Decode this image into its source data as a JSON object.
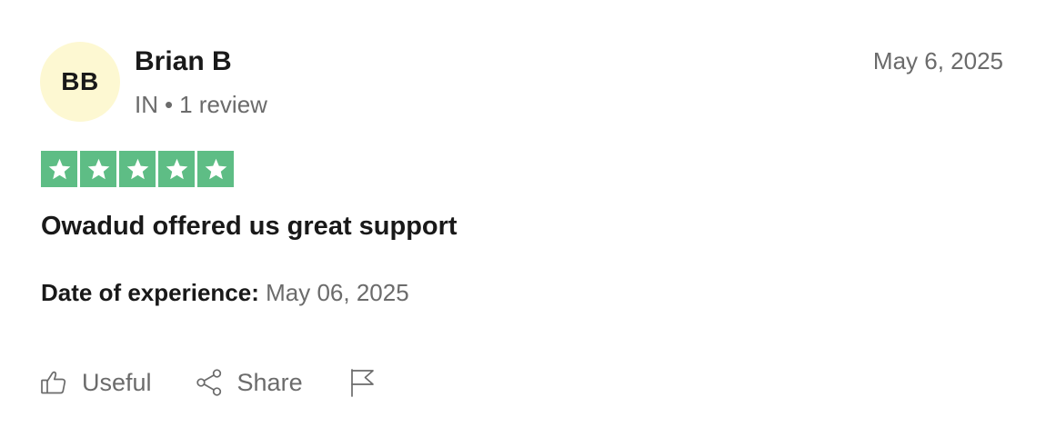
{
  "reviewer": {
    "initials": "BB",
    "name": "Brian B",
    "country": "IN",
    "separator": "•",
    "review_count": "1 review"
  },
  "review": {
    "date": "May 6, 2025",
    "rating": 5,
    "rating_max": 5,
    "title": "Owadud offered us great support",
    "experience_label": "Date of experience:",
    "experience_date": "May 06, 2025"
  },
  "actions": {
    "useful_label": "Useful",
    "share_label": "Share",
    "useful_icon": "thumbs-up-icon",
    "share_icon": "share-icon",
    "report_icon": "flag-icon"
  },
  "colors": {
    "star_fill": "#5ebd85",
    "avatar_bg": "#fdf8d2",
    "muted_text": "#6b6b6b",
    "primary_text": "#191919"
  }
}
